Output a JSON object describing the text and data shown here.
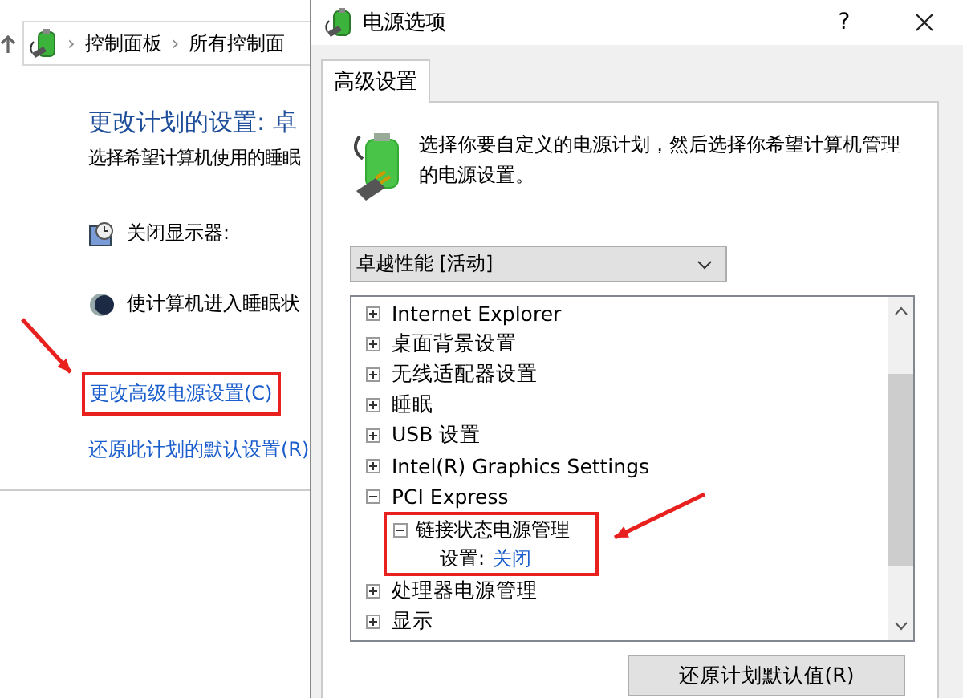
{
  "background_window": {
    "breadcrumb_separator": "›",
    "breadcrumb": [
      "控制面板",
      "所有控制面"
    ],
    "heading": "更改计划的设置: 卓",
    "subtitle": "选择希望计算机使用的睡眠",
    "settings": [
      {
        "kind": "display",
        "label": "关闭显示器:"
      },
      {
        "kind": "sleep",
        "label": "使计算机进入睡眠状"
      }
    ],
    "links": [
      {
        "label": "更改高级电源设置(C)",
        "highlighted": true
      },
      {
        "label": "还原此计划的默认设置(R)",
        "highlighted": false
      }
    ]
  },
  "dialog": {
    "title": "电源选项",
    "help": "?",
    "tabs": [
      {
        "label": "高级设置",
        "selected": true
      }
    ],
    "description": "选择你要自定义的电源计划，然后选择你希望计算机管理的电源设置。",
    "plan_select": {
      "value": "卓越性能 [活动]"
    },
    "tree": [
      {
        "label": "Internet Explorer",
        "expanded": false
      },
      {
        "label": "桌面背景设置",
        "expanded": false
      },
      {
        "label": "无线适配器设置",
        "expanded": false
      },
      {
        "label": "睡眠",
        "expanded": false
      },
      {
        "label": "USB 设置",
        "expanded": false
      },
      {
        "label": "Intel(R) Graphics Settings",
        "expanded": false
      },
      {
        "label": "PCI Express",
        "expanded": true,
        "children": [
          {
            "label": "链接状态电源管理",
            "expanded": true,
            "highlighted": true,
            "setting": {
              "label": "设置:",
              "value": "关闭"
            }
          }
        ]
      },
      {
        "label": "处理器电源管理",
        "expanded": false
      },
      {
        "label": "显示",
        "expanded": false
      }
    ],
    "button": {
      "label": "还原计划默认值(R)"
    }
  }
}
